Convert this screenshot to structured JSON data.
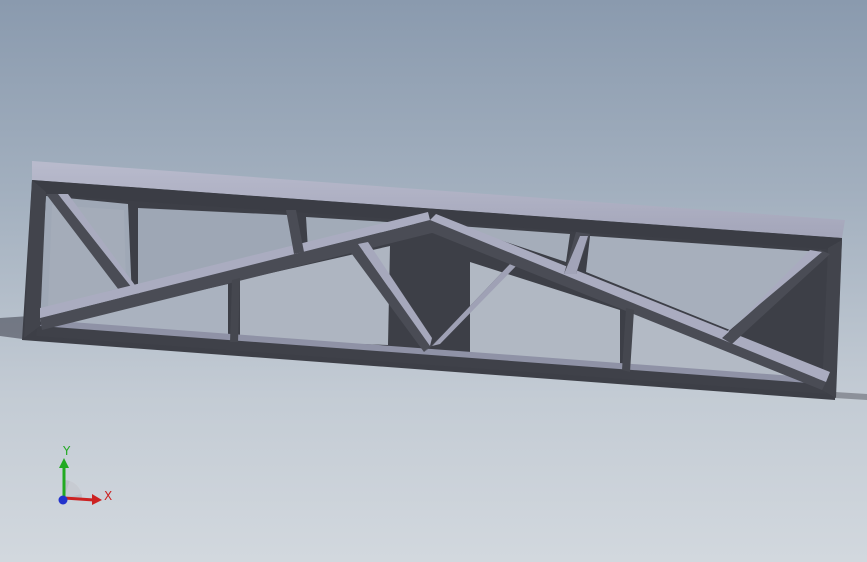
{
  "viewport": {
    "background_top": "#8a9aae",
    "background_bottom": "#d2d8de"
  },
  "model": {
    "name": "truss-frame",
    "face_light": "#aeb0c4",
    "face_mid": "#9a9cb2",
    "face_dark": "#3a3c44",
    "cylinder": "#74778a"
  },
  "triad": {
    "x_label": "X",
    "y_label": "Y",
    "x_color": "#cc2222",
    "y_color": "#22aa22",
    "z_color": "#2233cc"
  }
}
